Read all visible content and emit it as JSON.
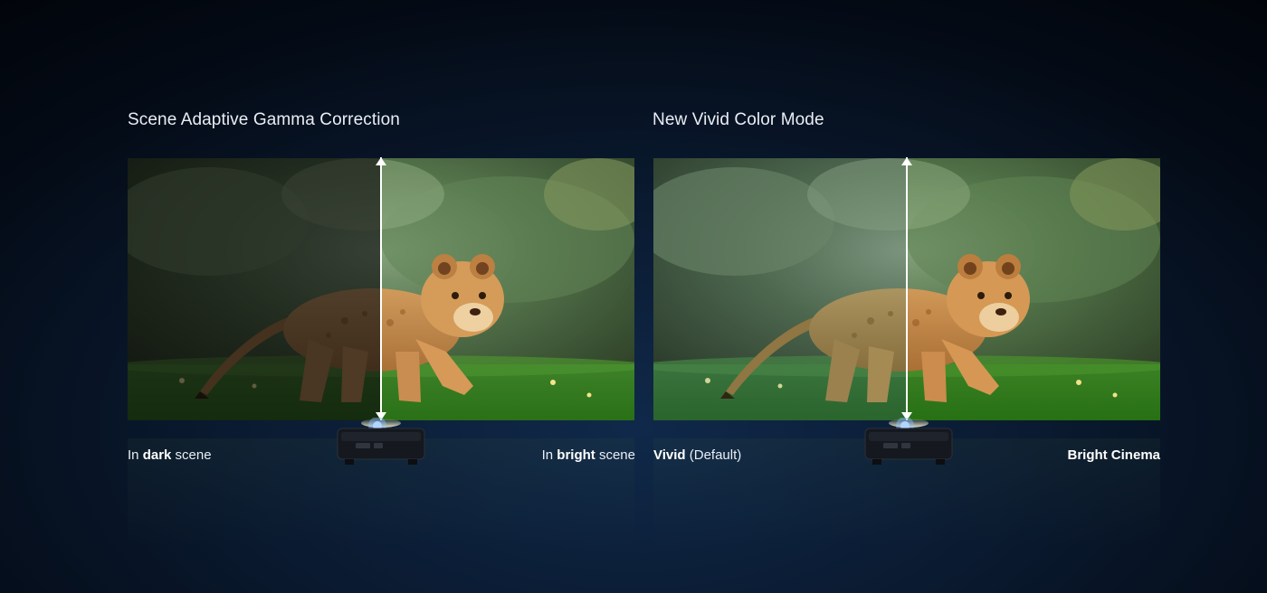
{
  "panels": [
    {
      "title": "Scene Adaptive Gamma Correction",
      "left_caption": {
        "prefix": "In ",
        "bold": "dark",
        "suffix": " scene"
      },
      "right_caption": {
        "prefix": "In ",
        "bold": "bright",
        "suffix": " scene"
      }
    },
    {
      "title": "New Vivid Color Mode",
      "left_caption": {
        "prefix": "",
        "bold": "Vivid",
        "suffix": " (Default)"
      },
      "right_caption": {
        "prefix": "",
        "bold": "Bright Cinema",
        "suffix": ""
      }
    }
  ],
  "icons": [
    "projector-icon",
    "double-arrow-divider-icon"
  ],
  "colors": {
    "background": "#061224",
    "text": "#e9eef5",
    "divider": "#ffffff"
  }
}
